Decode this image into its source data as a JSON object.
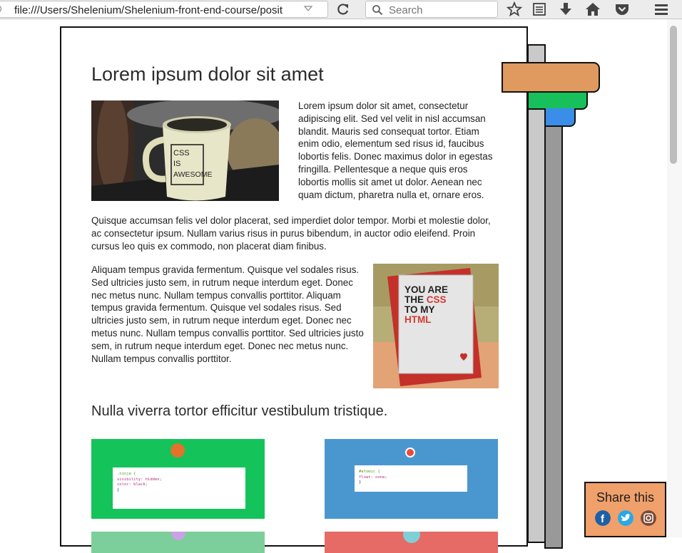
{
  "browser": {
    "url": "file:///Users/Shelenium/Shelenium-front-end-course/posit",
    "search_placeholder": "Search",
    "toolbar_icons": [
      "bookmark-star-icon",
      "reading-list-icon",
      "download-icon",
      "home-icon",
      "pocket-icon",
      "menu-icon"
    ]
  },
  "article": {
    "title": "Lorem ipsum dolor sit amet",
    "image1": {
      "mug_text_lines": [
        "CSS",
        "IS",
        "AWESOME"
      ]
    },
    "para1": "Lorem ipsum dolor sit amet, consectetur adipiscing elit. Sed vel velit in nisl accumsan blandit. Mauris sed consequat tortor. Etiam enim odio, elementum sed risus id, faucibus lobortis felis. Donec maximus dolor in egestas fringilla. Pellentesque a neque quis eros lobortis mollis sit amet ut dolor. Aenean nec quam dictum, pharetra nulla et, ornare eros.",
    "para2": "Quisque accumsan felis vel dolor placerat, sed imperdiet dolor tempor. Morbi et molestie dolor, ac consectetur ipsum. Nullam varius risus in purus bibendum, in auctor odio eleifend. Proin cursus leo quis ex commodo, non placerat diam finibus.",
    "para3": "Aliquam tempus gravida fermentum. Quisque vel sodales risus. Sed ultricies justo sem, in rutrum neque interdum eget. Donec nec metus nunc. Nullam tempus convallis porttitor. Aliquam tempus gravida fermentum. Quisque vel sodales risus. Sed ultricies justo sem, in rutrum neque interdum eget. Donec nec metus nunc. Nullam tempus convallis porttitor. Sed ultricies justo sem, in rutrum neque interdum eget. Donec nec metus nunc. Nullam tempus convallis porttitor.",
    "image2": {
      "card_lines": [
        "YOU ARE",
        "THE ",
        "CSS",
        "TO MY",
        "HTML"
      ]
    },
    "subtitle": "Nulla viverra tortor efficitur vestibulum tristique.",
    "thumb1": {
      "code": [
        ".ninja {",
        "visibility: hidden;",
        "color: black;",
        "}"
      ]
    },
    "thumb2": {
      "code": [
        "#atomic {",
        "float: none;",
        "}"
      ]
    }
  },
  "share": {
    "label": "Share this",
    "networks": [
      "facebook-icon",
      "twitter-icon",
      "instagram-icon"
    ]
  },
  "colors": {
    "tab_orange": "#e0995e",
    "tab_green": "#17c05a",
    "tab_blue": "#3a8de9",
    "share_bg": "#f0a06a",
    "thumb_green": "#14c45a",
    "thumb_blue": "#4a97cf"
  }
}
